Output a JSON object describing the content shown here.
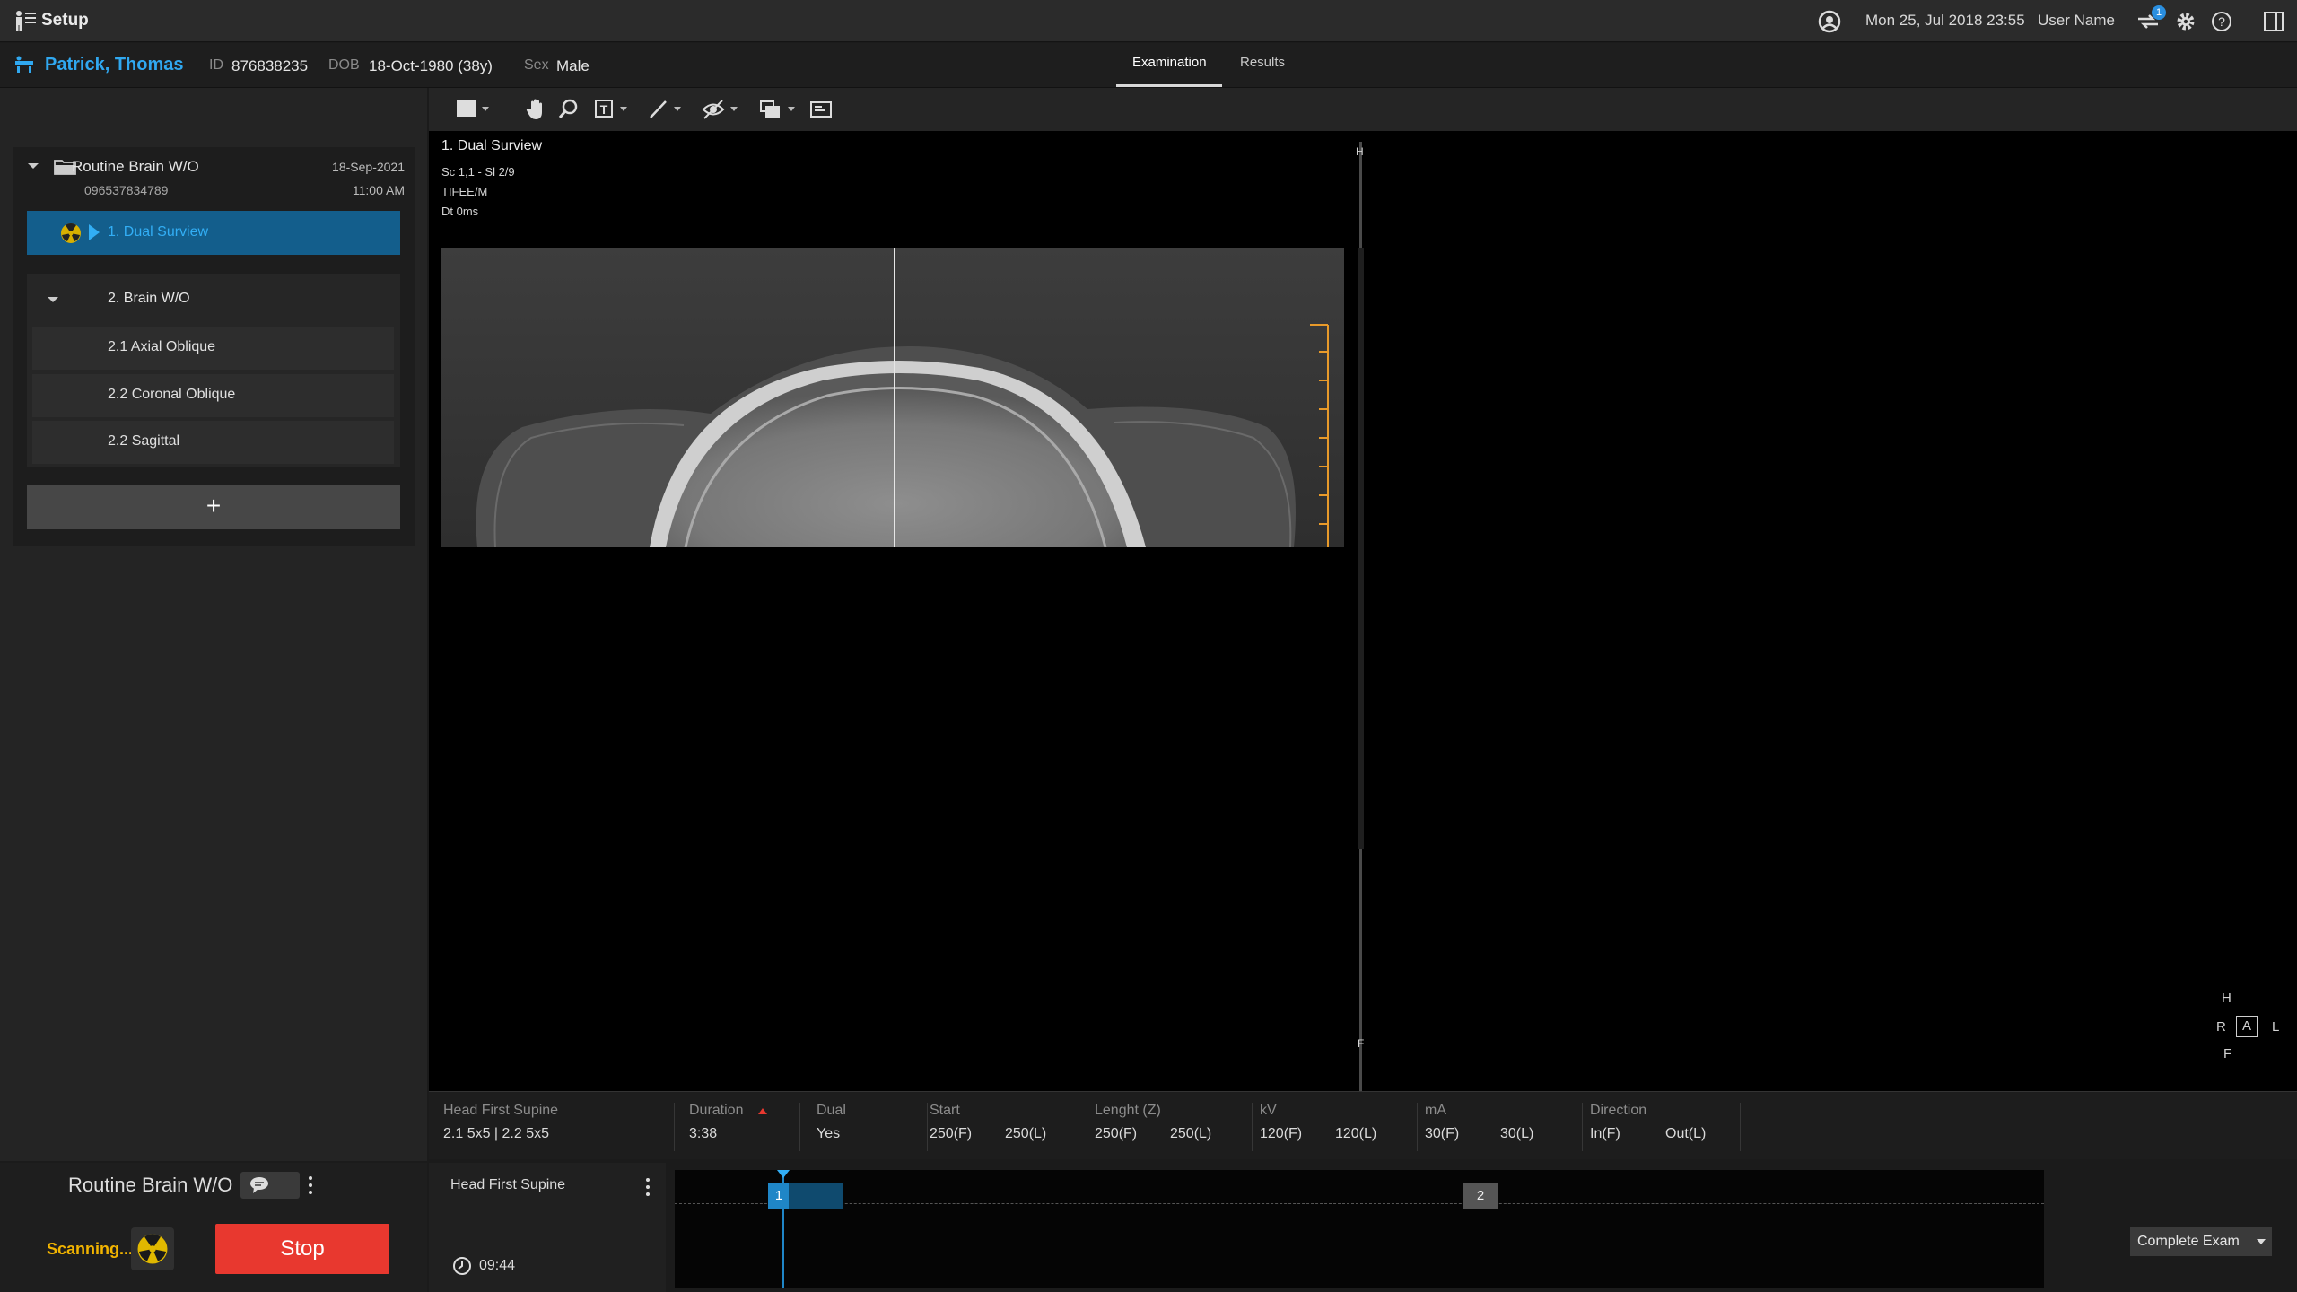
{
  "app": {
    "title": "Setup",
    "datetime": "Mon 25, Jul 2018  23:55",
    "user_name": "User Name",
    "notification_count": "1"
  },
  "patient": {
    "name": "Patrick, Thomas",
    "id_label": "ID",
    "id": "876838235",
    "dob_label": "DOB",
    "dob": "18-Oct-1980 (38y)",
    "sex_label": "Sex",
    "sex": "Male"
  },
  "tabs": [
    {
      "label": "Examination",
      "active": true
    },
    {
      "label": "Results",
      "active": false
    }
  ],
  "exam": {
    "title": "Routine Brain W/O",
    "id": "096537834789",
    "date": "18-Sep-2021",
    "time": "11:00 AM",
    "active_item": "1. Dual Surview",
    "group_title": "2. Brain W/O",
    "sub_items": [
      "2.1 Axial Oblique",
      "2.2 Coronal Oblique",
      "2.2 Sagittal"
    ],
    "add_label": "+"
  },
  "viewer": {
    "series_title": "1. Dual Surview",
    "line1": "Sc 1,1 - Sl 2/9",
    "line2": "TIFEE/M",
    "line3": "Dt 0ms",
    "top_marker": "H",
    "bottom_marker": "F",
    "orientation": {
      "top": "H",
      "left": "R",
      "center": "A",
      "right": "L",
      "bottom": "F"
    }
  },
  "params": [
    {
      "header": "Head First Supine",
      "values": [
        "2.1 5x5  |  2.2 5x5"
      ]
    },
    {
      "header": "Duration",
      "values": [
        "3:38"
      ],
      "sort_icon": "triangle-up-icon"
    },
    {
      "header": "Dual",
      "values": [
        "Yes"
      ]
    },
    {
      "header": "Start",
      "values": [
        "250(F)",
        "250(L)"
      ]
    },
    {
      "header": "Lenght (Z)",
      "values": [
        "250(F)",
        "250(L)"
      ]
    },
    {
      "header": "kV",
      "values": [
        "120(F)",
        "120(L)"
      ]
    },
    {
      "header": "mA",
      "values": [
        "30(F)",
        "30(L)"
      ]
    },
    {
      "header": "Direction",
      "values": [
        "In(F)",
        "Out(L)"
      ]
    }
  ],
  "bottom": {
    "exam_title": "Routine Brain W/O",
    "scanning_label": "Scanning...",
    "stop_label": "Stop",
    "position_label": "Head First Supine",
    "elapsed": "09:44",
    "block1": "1",
    "block2": "2",
    "complete_label": "Complete Exam"
  },
  "colors": {
    "accent": "#30a8f0",
    "active_item_bg": "#135e8c",
    "stop": "#e8382f",
    "scanning": "#f2b400",
    "ruler": "#e89a2a"
  }
}
